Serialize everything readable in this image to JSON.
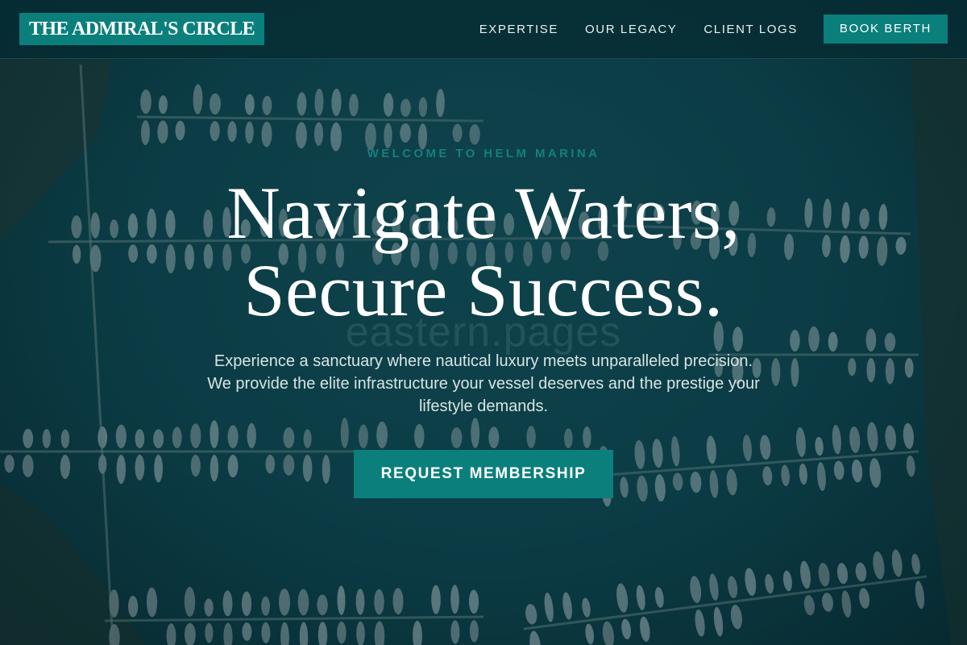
{
  "header": {
    "logo_text": "THE ADMIRAL'S CIRCLE",
    "nav": [
      {
        "label": "EXPERTISE"
      },
      {
        "label": "OUR LEGACY"
      },
      {
        "label": "CLIENT LOGS"
      }
    ],
    "book_label": "BOOK BERTH"
  },
  "hero": {
    "eyebrow": "WELCOME TO HELM MARINA",
    "headline_line1": "Navigate Waters,",
    "headline_line2": "Secure Success.",
    "watermark": "eastern.pages",
    "subtext": "Experience a sanctuary where nautical luxury meets unparalleled precision. We provide the elite infrastructure your vessel deserves and the prestige your lifestyle demands.",
    "cta_label": "REQUEST MEMBERSHIP"
  },
  "colors": {
    "accent": "#0b7f7c",
    "header_bg": "#062c32",
    "water": "#0e4650",
    "eyebrow": "#13807c",
    "text_primary": "#ffffff",
    "text_secondary": "#d8e4e4"
  }
}
